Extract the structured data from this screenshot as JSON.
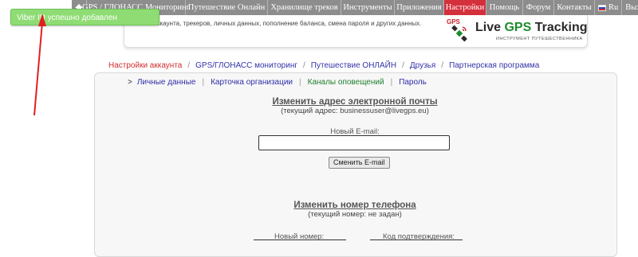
{
  "nav": {
    "items": [
      {
        "label": "GPS / ГЛОНАСС Мониторинг",
        "width": 124
      },
      {
        "label": "Путешествие Онлайн",
        "width": 103
      },
      {
        "label": "Хранилище треков",
        "width": 92
      },
      {
        "label": "Инструменты",
        "width": 67
      },
      {
        "label": "Приложения",
        "width": 62
      },
      {
        "label": "Настройки",
        "width": 53
      },
      {
        "label": "Помощь",
        "width": 46
      },
      {
        "label": "Форум",
        "width": 39
      },
      {
        "label": "Контакты",
        "width": 51
      },
      {
        "label": "Ru",
        "width": 44
      },
      {
        "label": "Выход",
        "width": 40
      }
    ]
  },
  "banner": {
    "text": "...аккаунта, трекеров, личных данных, пополнение баланса, смена пароля и других данных.",
    "logo_gps": "GPS",
    "logo_live": "Live ",
    "logo_gps_word": "GPS",
    "logo_tracking": " Tracking",
    "logo_sub": "ИНСТРУМЕНТ ПУТЕШЕСТВЕННИКА"
  },
  "toast": {
    "message": "Viber ID успешно добавлен"
  },
  "subnav": {
    "items": [
      "Настройки аккаунта",
      "GPS/ГЛОНАСС мониторинг",
      "Путешествие ОНЛАЙН",
      "Друзья",
      "Партнерская программа"
    ]
  },
  "tabs": {
    "items": [
      "Личные данные",
      "Карточка организации",
      "Каналы оповещений",
      "Пароль"
    ]
  },
  "email_section": {
    "title": "Изменить адрес электронной почты",
    "current": "(текущий адрес: businessuser@livegps.eu)",
    "new_label": "Новый E-mail:",
    "input_value": "",
    "button": "Сменить E-mail"
  },
  "phone_section": {
    "title": "Изменить номер телефона",
    "current": "(текущий номер: не задан)",
    "new_label": "Новый номер:",
    "code_label": "Код подтверждения:"
  },
  "colors": {
    "nav_bg": "#8d8d8d",
    "nav_active": "#d4303c",
    "toast_bg": "#8fdc74",
    "link": "#3333a8",
    "link_active": "#d12c2c",
    "tab_active": "#1e7e2c",
    "annotation_arrow": "#e02020"
  }
}
